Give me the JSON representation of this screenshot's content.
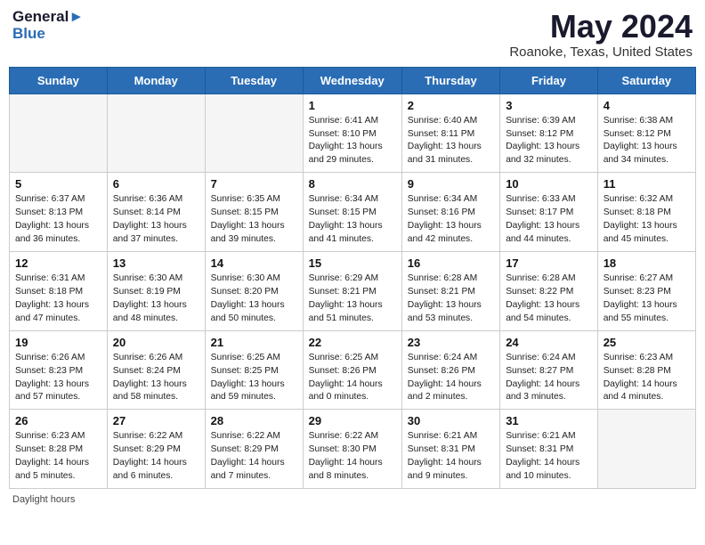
{
  "header": {
    "logo_line1": "General",
    "logo_line2": "Blue",
    "month_title": "May 2024",
    "location": "Roanoke, Texas, United States"
  },
  "days_of_week": [
    "Sunday",
    "Monday",
    "Tuesday",
    "Wednesday",
    "Thursday",
    "Friday",
    "Saturday"
  ],
  "weeks": [
    [
      {
        "num": "",
        "info": ""
      },
      {
        "num": "",
        "info": ""
      },
      {
        "num": "",
        "info": ""
      },
      {
        "num": "1",
        "info": "Sunrise: 6:41 AM\nSunset: 8:10 PM\nDaylight: 13 hours and 29 minutes."
      },
      {
        "num": "2",
        "info": "Sunrise: 6:40 AM\nSunset: 8:11 PM\nDaylight: 13 hours and 31 minutes."
      },
      {
        "num": "3",
        "info": "Sunrise: 6:39 AM\nSunset: 8:12 PM\nDaylight: 13 hours and 32 minutes."
      },
      {
        "num": "4",
        "info": "Sunrise: 6:38 AM\nSunset: 8:12 PM\nDaylight: 13 hours and 34 minutes."
      }
    ],
    [
      {
        "num": "5",
        "info": "Sunrise: 6:37 AM\nSunset: 8:13 PM\nDaylight: 13 hours and 36 minutes."
      },
      {
        "num": "6",
        "info": "Sunrise: 6:36 AM\nSunset: 8:14 PM\nDaylight: 13 hours and 37 minutes."
      },
      {
        "num": "7",
        "info": "Sunrise: 6:35 AM\nSunset: 8:15 PM\nDaylight: 13 hours and 39 minutes."
      },
      {
        "num": "8",
        "info": "Sunrise: 6:34 AM\nSunset: 8:15 PM\nDaylight: 13 hours and 41 minutes."
      },
      {
        "num": "9",
        "info": "Sunrise: 6:34 AM\nSunset: 8:16 PM\nDaylight: 13 hours and 42 minutes."
      },
      {
        "num": "10",
        "info": "Sunrise: 6:33 AM\nSunset: 8:17 PM\nDaylight: 13 hours and 44 minutes."
      },
      {
        "num": "11",
        "info": "Sunrise: 6:32 AM\nSunset: 8:18 PM\nDaylight: 13 hours and 45 minutes."
      }
    ],
    [
      {
        "num": "12",
        "info": "Sunrise: 6:31 AM\nSunset: 8:18 PM\nDaylight: 13 hours and 47 minutes."
      },
      {
        "num": "13",
        "info": "Sunrise: 6:30 AM\nSunset: 8:19 PM\nDaylight: 13 hours and 48 minutes."
      },
      {
        "num": "14",
        "info": "Sunrise: 6:30 AM\nSunset: 8:20 PM\nDaylight: 13 hours and 50 minutes."
      },
      {
        "num": "15",
        "info": "Sunrise: 6:29 AM\nSunset: 8:21 PM\nDaylight: 13 hours and 51 minutes."
      },
      {
        "num": "16",
        "info": "Sunrise: 6:28 AM\nSunset: 8:21 PM\nDaylight: 13 hours and 53 minutes."
      },
      {
        "num": "17",
        "info": "Sunrise: 6:28 AM\nSunset: 8:22 PM\nDaylight: 13 hours and 54 minutes."
      },
      {
        "num": "18",
        "info": "Sunrise: 6:27 AM\nSunset: 8:23 PM\nDaylight: 13 hours and 55 minutes."
      }
    ],
    [
      {
        "num": "19",
        "info": "Sunrise: 6:26 AM\nSunset: 8:23 PM\nDaylight: 13 hours and 57 minutes."
      },
      {
        "num": "20",
        "info": "Sunrise: 6:26 AM\nSunset: 8:24 PM\nDaylight: 13 hours and 58 minutes."
      },
      {
        "num": "21",
        "info": "Sunrise: 6:25 AM\nSunset: 8:25 PM\nDaylight: 13 hours and 59 minutes."
      },
      {
        "num": "22",
        "info": "Sunrise: 6:25 AM\nSunset: 8:26 PM\nDaylight: 14 hours and 0 minutes."
      },
      {
        "num": "23",
        "info": "Sunrise: 6:24 AM\nSunset: 8:26 PM\nDaylight: 14 hours and 2 minutes."
      },
      {
        "num": "24",
        "info": "Sunrise: 6:24 AM\nSunset: 8:27 PM\nDaylight: 14 hours and 3 minutes."
      },
      {
        "num": "25",
        "info": "Sunrise: 6:23 AM\nSunset: 8:28 PM\nDaylight: 14 hours and 4 minutes."
      }
    ],
    [
      {
        "num": "26",
        "info": "Sunrise: 6:23 AM\nSunset: 8:28 PM\nDaylight: 14 hours and 5 minutes."
      },
      {
        "num": "27",
        "info": "Sunrise: 6:22 AM\nSunset: 8:29 PM\nDaylight: 14 hours and 6 minutes."
      },
      {
        "num": "28",
        "info": "Sunrise: 6:22 AM\nSunset: 8:29 PM\nDaylight: 14 hours and 7 minutes."
      },
      {
        "num": "29",
        "info": "Sunrise: 6:22 AM\nSunset: 8:30 PM\nDaylight: 14 hours and 8 minutes."
      },
      {
        "num": "30",
        "info": "Sunrise: 6:21 AM\nSunset: 8:31 PM\nDaylight: 14 hours and 9 minutes."
      },
      {
        "num": "31",
        "info": "Sunrise: 6:21 AM\nSunset: 8:31 PM\nDaylight: 14 hours and 10 minutes."
      },
      {
        "num": "",
        "info": ""
      }
    ]
  ],
  "footer": {
    "note": "Daylight hours"
  }
}
